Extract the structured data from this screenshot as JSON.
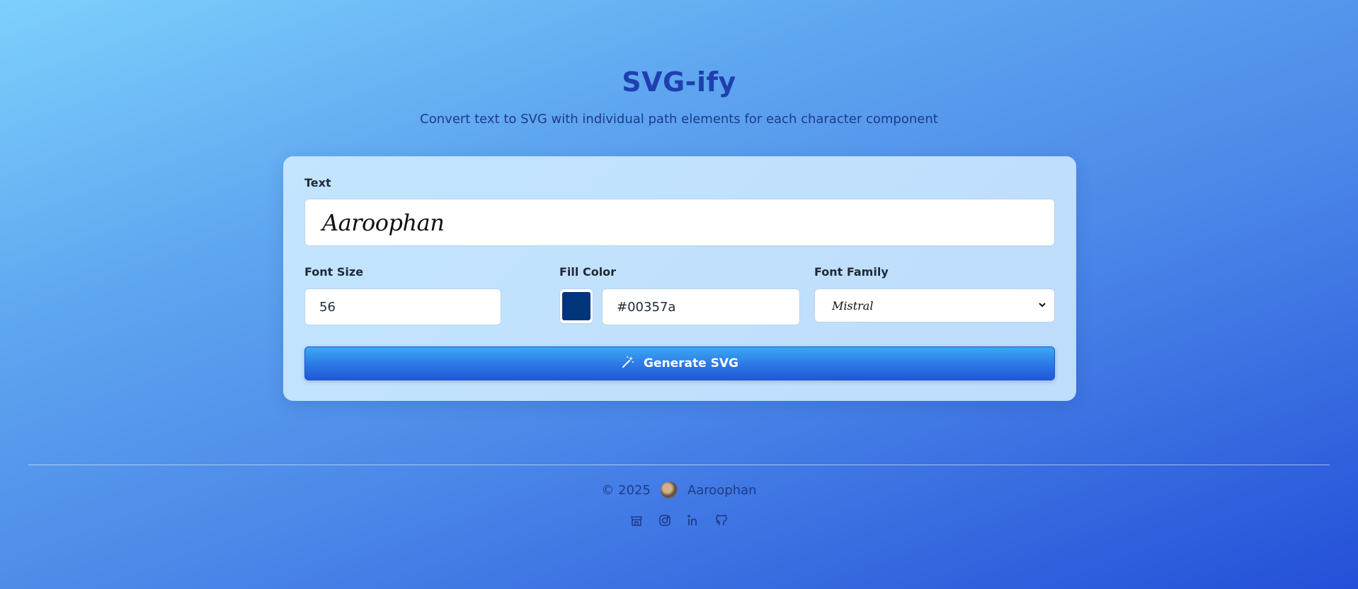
{
  "header": {
    "title": "SVG-ify",
    "subtitle": "Convert text to SVG with individual path elements for each character component"
  },
  "form": {
    "text_label": "Text",
    "text_value": "Aaroophan",
    "font_size_label": "Font Size",
    "font_size_value": "56",
    "fill_color_label": "Fill Color",
    "fill_color_value": "#00357a",
    "font_family_label": "Font Family",
    "font_family_value": "Mistral",
    "generate_label": "Generate SVG"
  },
  "footer": {
    "copyright": "© 2025",
    "author": "Aaroophan",
    "social_icons": [
      "store-icon",
      "instagram-icon",
      "linkedin-icon",
      "github-icon"
    ]
  },
  "colors": {
    "title": "#1e40af",
    "swatch": "#00357a",
    "button_start": "#3aaaf4",
    "button_end": "#1f58d8"
  }
}
